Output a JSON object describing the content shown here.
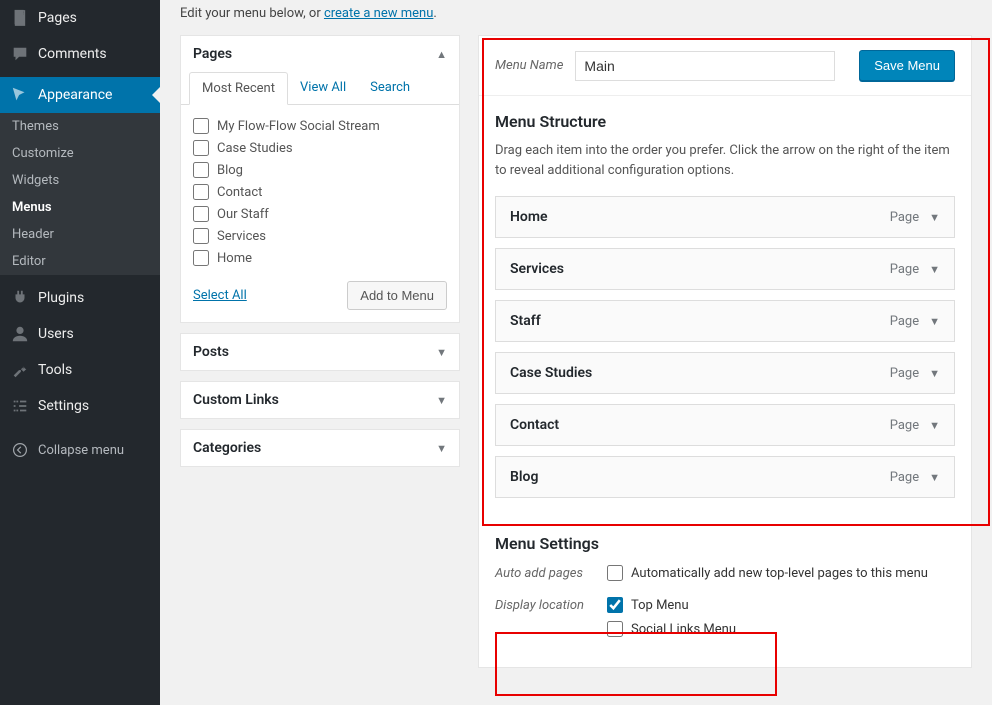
{
  "sidebar": {
    "items": [
      {
        "label": "Pages",
        "icon": "pages"
      },
      {
        "label": "Comments",
        "icon": "comments"
      },
      {
        "label": "Appearance",
        "icon": "appearance",
        "current": true,
        "sub": [
          {
            "label": "Themes"
          },
          {
            "label": "Customize"
          },
          {
            "label": "Widgets"
          },
          {
            "label": "Menus",
            "active": true
          },
          {
            "label": "Header"
          },
          {
            "label": "Editor"
          }
        ]
      },
      {
        "label": "Plugins",
        "icon": "plugins"
      },
      {
        "label": "Users",
        "icon": "users"
      },
      {
        "label": "Tools",
        "icon": "tools"
      },
      {
        "label": "Settings",
        "icon": "settings"
      }
    ],
    "collapse": "Collapse menu"
  },
  "intro": {
    "prefix": "Edit your menu below, or ",
    "link": "create a new menu",
    "suffix": "."
  },
  "left_panel": {
    "pages": {
      "title": "Pages",
      "tabs": [
        "Most Recent",
        "View All",
        "Search"
      ],
      "items": [
        "My Flow-Flow Social Stream",
        "Case Studies",
        "Blog",
        "Contact",
        "Our Staff",
        "Services",
        "Home"
      ],
      "select_all": "Select All",
      "add_btn": "Add to Menu"
    },
    "posts": "Posts",
    "custom_links": "Custom Links",
    "categories": "Categories"
  },
  "menu_panel": {
    "name_label": "Menu Name",
    "name_value": "Main",
    "save_btn": "Save Menu",
    "structure_title": "Menu Structure",
    "structure_desc": "Drag each item into the order you prefer. Click the arrow on the right of the item to reveal additional configuration options.",
    "items": [
      {
        "title": "Home",
        "type": "Page"
      },
      {
        "title": "Services",
        "type": "Page"
      },
      {
        "title": "Staff",
        "type": "Page"
      },
      {
        "title": "Case Studies",
        "type": "Page"
      },
      {
        "title": "Contact",
        "type": "Page"
      },
      {
        "title": "Blog",
        "type": "Page"
      }
    ],
    "settings_title": "Menu Settings",
    "auto_add_label": "Auto add pages",
    "auto_add_option": "Automatically add new top-level pages to this menu",
    "display_label": "Display location",
    "display_options": [
      {
        "label": "Top Menu",
        "checked": true
      },
      {
        "label": "Social Links Menu",
        "checked": false
      }
    ]
  }
}
